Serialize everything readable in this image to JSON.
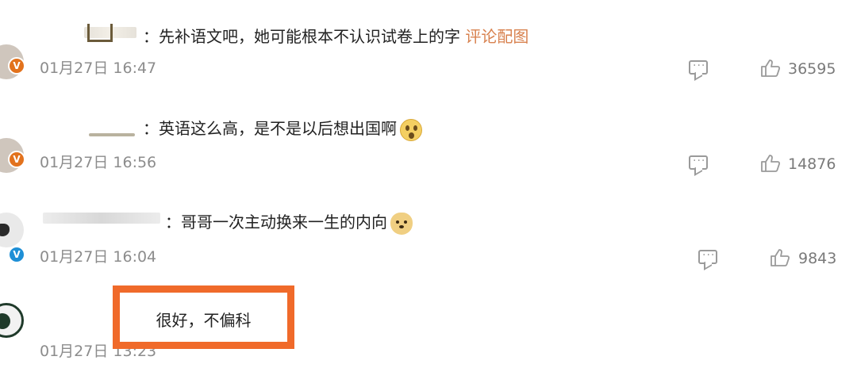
{
  "comments": [
    {
      "text": "先补语文吧，她可能根本不认识试卷上的字",
      "link": "评论配图",
      "timestamp": "01月27日 16:47",
      "likes": "36595",
      "badge": "V",
      "badge_color": "#e2721d"
    },
    {
      "text": "英语这么高，是不是以后想出国啊",
      "emoji": "shocked-face-emoji",
      "timestamp": "01月27日 16:56",
      "likes": "14876",
      "badge": "V",
      "badge_color": "#e2721d"
    },
    {
      "text": "哥哥一次主动换来一生的内向",
      "emoji": "doge-emoji",
      "timestamp": "01月27日 16:04",
      "likes": "9843",
      "badge": "V",
      "badge_color": "#1e8fd6"
    },
    {
      "timestamp": "01月27日 13:23",
      "highlight": "很好，不偏科",
      "highlight_color": "#f06a2a"
    }
  ],
  "colon": "："
}
